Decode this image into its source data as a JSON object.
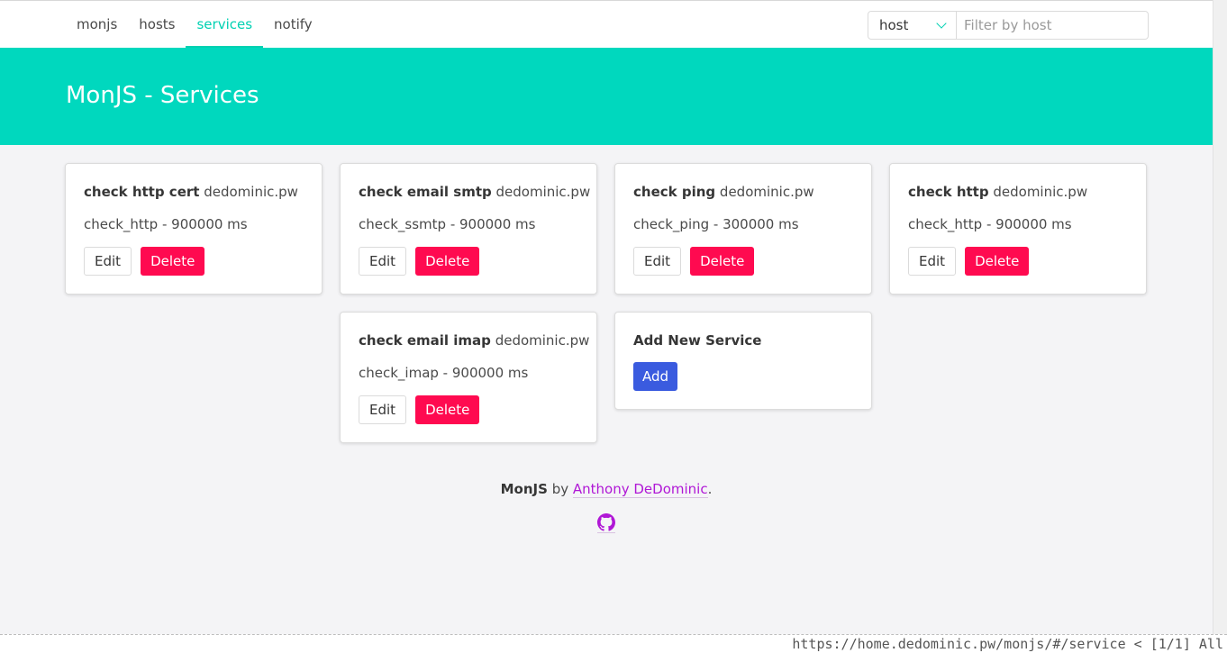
{
  "nav": {
    "tabs": [
      {
        "label": "monjs"
      },
      {
        "label": "hosts"
      },
      {
        "label": "services"
      },
      {
        "label": "notify"
      }
    ],
    "filter_select": "host",
    "filter_placeholder": "Filter by host"
  },
  "hero": {
    "title": "MonJS - Services"
  },
  "services": [
    {
      "name": "check http cert",
      "host": "dedominic.pw",
      "detail": "check_http - 900000 ms",
      "edit": "Edit",
      "delete": "Delete"
    },
    {
      "name": "check email smtp",
      "host": "dedominic.pw",
      "detail": "check_ssmtp - 900000 ms",
      "edit": "Edit",
      "delete": "Delete"
    },
    {
      "name": "check ping",
      "host": "dedominic.pw",
      "detail": "check_ping - 300000 ms",
      "edit": "Edit",
      "delete": "Delete"
    },
    {
      "name": "check http",
      "host": "dedominic.pw",
      "detail": "check_http - 900000 ms",
      "edit": "Edit",
      "delete": "Delete"
    },
    {
      "name": "check email imap",
      "host": "dedominic.pw",
      "detail": "check_imap - 900000 ms",
      "edit": "Edit",
      "delete": "Delete"
    }
  ],
  "add_card": {
    "title": "Add New Service",
    "button": "Add"
  },
  "footer": {
    "app": "MonJS",
    "by": "by",
    "author": "Anthony DeDominic",
    "period": ".",
    "icon": "github-icon"
  },
  "status_bar": {
    "text": "https://home.dedominic.pw/monjs/#/service < [1/1] All"
  },
  "colors": {
    "accent": "#00d1b2",
    "hero": "#00d8be",
    "danger": "#ff0a50",
    "primary": "#3a5bdf",
    "link": "#b017d6"
  }
}
